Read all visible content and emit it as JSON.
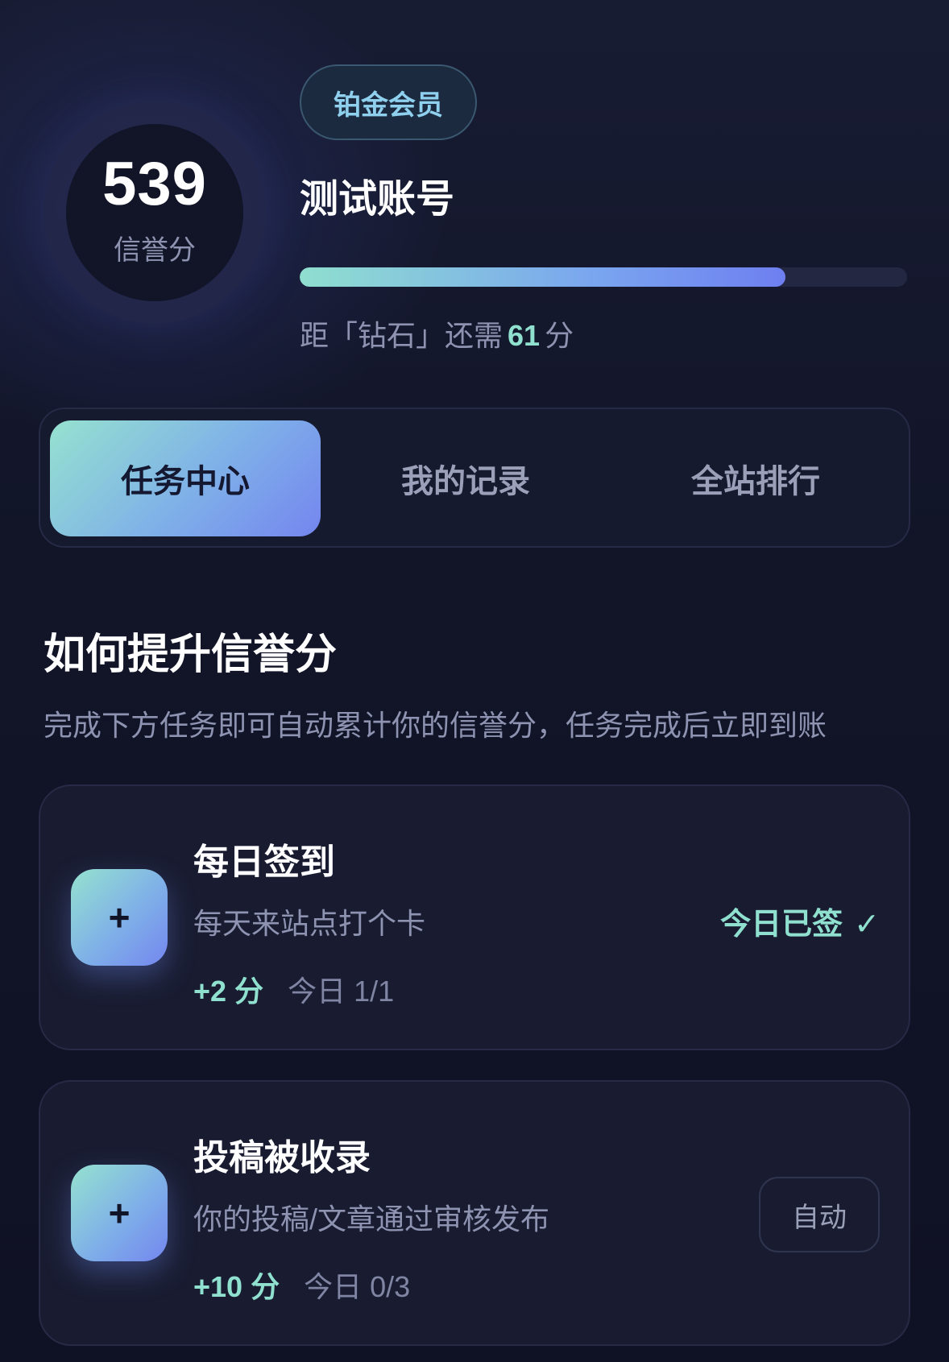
{
  "profile": {
    "score": "539",
    "score_label": "信誉分",
    "tier": "铂金会员",
    "account_name": "测试账号",
    "progress": 0.8,
    "next_tier_prefix": "距「钻石」还需",
    "next_tier_points": "61",
    "next_tier_suffix": "分"
  },
  "tabs": [
    {
      "label": "任务中心",
      "active": true
    },
    {
      "label": "我的记录",
      "active": false
    },
    {
      "label": "全站排行",
      "active": false
    }
  ],
  "section": {
    "title": "如何提升信誉分",
    "description": "完成下方任务即可自动累计你的信誉分，任务完成后立即到账"
  },
  "tasks": [
    {
      "icon": "plus-icon",
      "icon_glyph": "+",
      "title": "每日签到",
      "description": "每天来站点打个卡",
      "points": "+2 分",
      "daily": "今日 1/1",
      "status": "今日已签",
      "status_glyph": "✓"
    },
    {
      "icon": "plus-icon",
      "icon_glyph": "+",
      "title": "投稿被收录",
      "description": "你的投稿/文章通过审核发布",
      "points": "+10 分",
      "daily": "今日 0/3",
      "status": "自动"
    }
  ],
  "colors": {
    "accent": "#8fe0cf",
    "gradient_start": "#95e2cf",
    "gradient_end": "#7486ef",
    "background": "#121528"
  }
}
